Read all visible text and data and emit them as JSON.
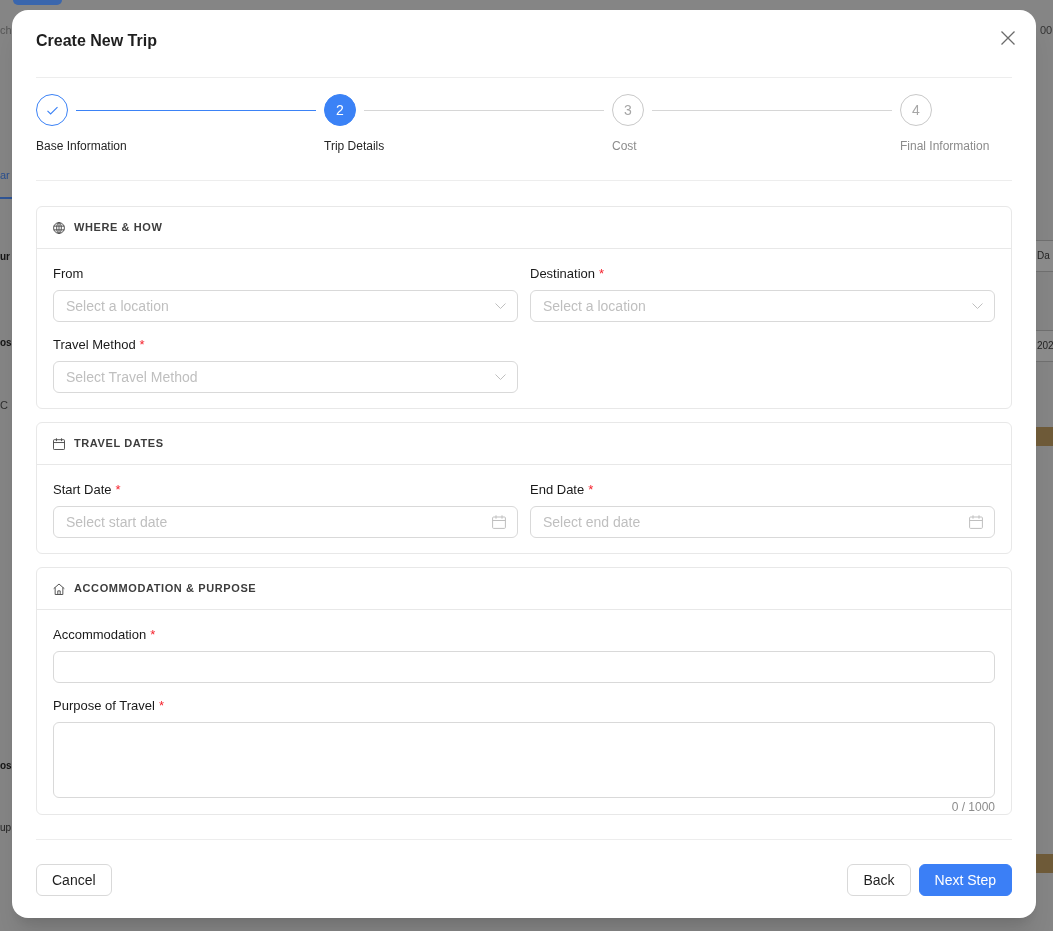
{
  "background_page": {
    "left": [
      {
        "kind": "search",
        "text": "ch"
      },
      {
        "kind": "tab",
        "text": "ar"
      },
      {
        "kind": "heading",
        "text": "ur"
      },
      {
        "kind": "heading",
        "text": "os"
      },
      {
        "kind": "text",
        "text": "C"
      },
      {
        "kind": "heading",
        "text": "os"
      },
      {
        "kind": "note",
        "text": "up"
      }
    ],
    "right": [
      {
        "kind": "text",
        "text": "00"
      },
      {
        "kind": "field",
        "text": "Da"
      },
      {
        "kind": "field",
        "text": "202"
      },
      {
        "kind": "bar"
      },
      {
        "kind": "bar"
      }
    ]
  },
  "dialog": {
    "title": "Create New Trip",
    "steps": [
      {
        "label": "Base Information",
        "completed": true,
        "selected": false
      },
      {
        "number": "2",
        "label": "Trip Details",
        "completed": false,
        "selected": true
      },
      {
        "number": "3",
        "label": "Cost",
        "completed": false,
        "selected": false
      },
      {
        "number": "4",
        "label": "Final Information",
        "completed": false,
        "selected": false
      }
    ],
    "sections": [
      {
        "title": "WHERE & HOW",
        "fields": [
          {
            "kind": "select",
            "label": "From",
            "placeholder": "Select a location"
          },
          {
            "kind": "select",
            "label": "Destination",
            "required_mark": "*",
            "placeholder": "Select a location"
          },
          {
            "kind": "select",
            "label": "Travel Method",
            "required_mark": "*",
            "placeholder": "Select Travel Method"
          }
        ]
      },
      {
        "title": "TRAVEL DATES",
        "fields": [
          {
            "kind": "date",
            "label": "Start Date",
            "required_mark": "*",
            "placeholder": "Select start date"
          },
          {
            "kind": "date",
            "label": "End Date",
            "required_mark": "*",
            "placeholder": "Select end date"
          }
        ]
      },
      {
        "title": "ACCOMMODATION & PURPOSE",
        "fields": [
          {
            "kind": "text",
            "label": "Accommodation",
            "required_mark": "*"
          },
          {
            "kind": "textarea",
            "label": "Purpose of Travel",
            "required_mark": "*",
            "counter": "0 / 1000"
          }
        ]
      }
    ],
    "footer": {
      "left_buttons": [
        {
          "label": "Cancel",
          "kind": "default"
        }
      ],
      "right_buttons": [
        {
          "label": "Back",
          "kind": "default"
        },
        {
          "label": "Next Step",
          "kind": "primary"
        }
      ]
    }
  }
}
